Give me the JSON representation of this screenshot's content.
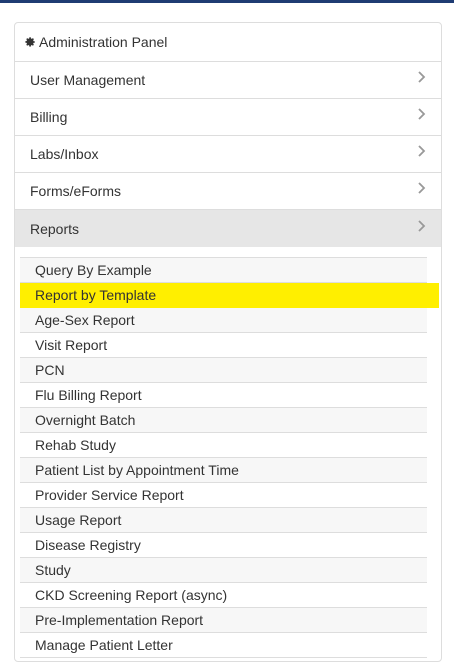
{
  "panel": {
    "title": "Administration Panel",
    "icon": "gear-icon"
  },
  "menu": [
    {
      "label": "User Management",
      "icon": "chevron-right-icon"
    },
    {
      "label": "Billing",
      "icon": "chevron-right-icon"
    },
    {
      "label": "Labs/Inbox",
      "icon": "chevron-right-icon"
    },
    {
      "label": "Forms/eForms",
      "icon": "chevron-right-icon"
    },
    {
      "label": "Reports",
      "icon": "chevron-right-icon",
      "expanded": true
    }
  ],
  "reports": [
    {
      "label": "Query By Example"
    },
    {
      "label": "Report by Template",
      "highlighted": true
    },
    {
      "label": "Age-Sex Report"
    },
    {
      "label": "Visit Report"
    },
    {
      "label": "PCN"
    },
    {
      "label": "Flu Billing Report"
    },
    {
      "label": "Overnight Batch"
    },
    {
      "label": "Rehab Study"
    },
    {
      "label": "Patient List by Appointment Time"
    },
    {
      "label": "Provider Service Report"
    },
    {
      "label": "Usage Report"
    },
    {
      "label": "Disease Registry"
    },
    {
      "label": "Study"
    },
    {
      "label": "CKD Screening Report (async)"
    },
    {
      "label": "Pre-Implementation Report"
    },
    {
      "label": "Manage Patient Letter"
    }
  ],
  "colors": {
    "highlight": "#ffef00",
    "active_bg": "#e6e6e6",
    "topbar": "#1f3c73"
  }
}
